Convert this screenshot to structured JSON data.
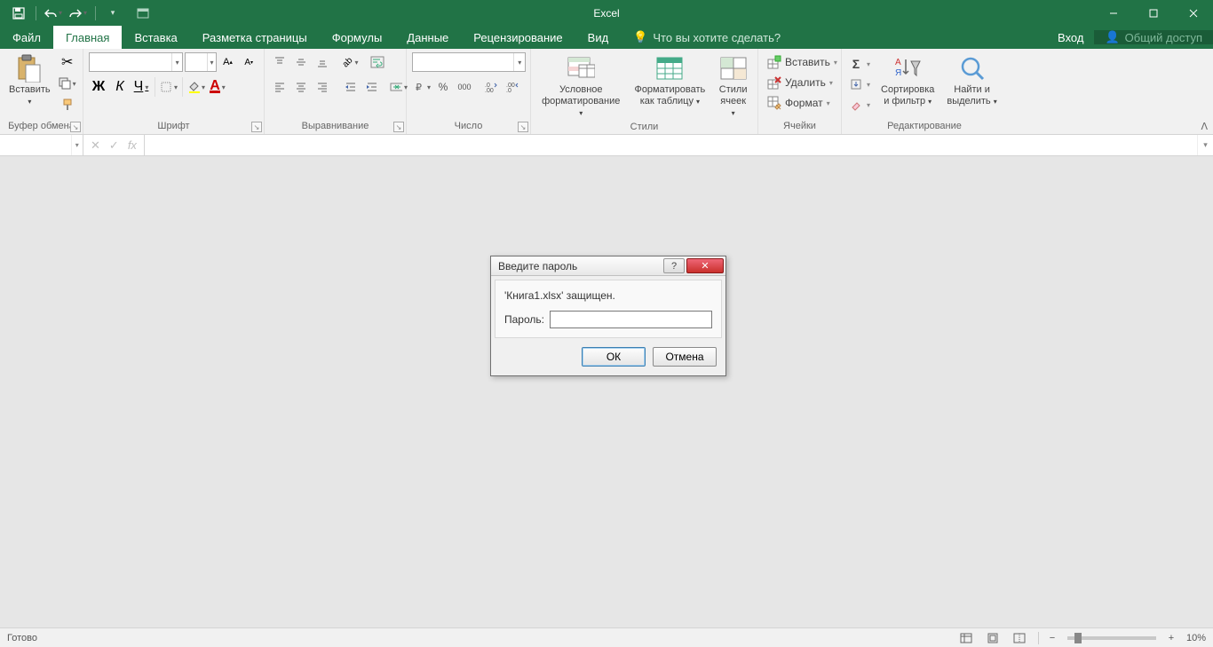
{
  "app": {
    "title": "Excel"
  },
  "tabs": {
    "file": "Файл",
    "home": "Главная",
    "insert": "Вставка",
    "pagelayout": "Разметка страницы",
    "formulas": "Формулы",
    "data": "Данные",
    "review": "Рецензирование",
    "view": "Вид",
    "tellme": "Что вы хотите сделать?",
    "signin": "Вход",
    "share": "Общий доступ"
  },
  "clipboard": {
    "paste": "Вставить",
    "label": "Буфер обмена"
  },
  "font": {
    "name": "",
    "size": "",
    "bold": "Ж",
    "italic": "К",
    "underline": "Ч",
    "label": "Шрифт"
  },
  "alignment": {
    "label": "Выравнивание"
  },
  "number": {
    "format": "",
    "percent": "%",
    "thousand": "000",
    "label": "Число"
  },
  "styles": {
    "condfmt1": "Условное",
    "condfmt2": "форматирование",
    "astable1": "Форматировать",
    "astable2": "как таблицу",
    "cellstyles1": "Стили",
    "cellstyles2": "ячеек",
    "label": "Стили"
  },
  "cells": {
    "insert": "Вставить",
    "delete": "Удалить",
    "format": "Формат",
    "label": "Ячейки"
  },
  "editing": {
    "sort1": "Сортировка",
    "sort2": "и фильтр",
    "find1": "Найти и",
    "find2": "выделить",
    "label": "Редактирование"
  },
  "formulabar": {
    "name": "",
    "formula": ""
  },
  "dialog": {
    "title": "Введите пароль",
    "message": "'Книга1.xlsx' защищен.",
    "pwlabel": "Пароль:",
    "ok": "ОК",
    "cancel": "Отмена"
  },
  "status": {
    "ready": "Готово",
    "zoom": "10%"
  }
}
